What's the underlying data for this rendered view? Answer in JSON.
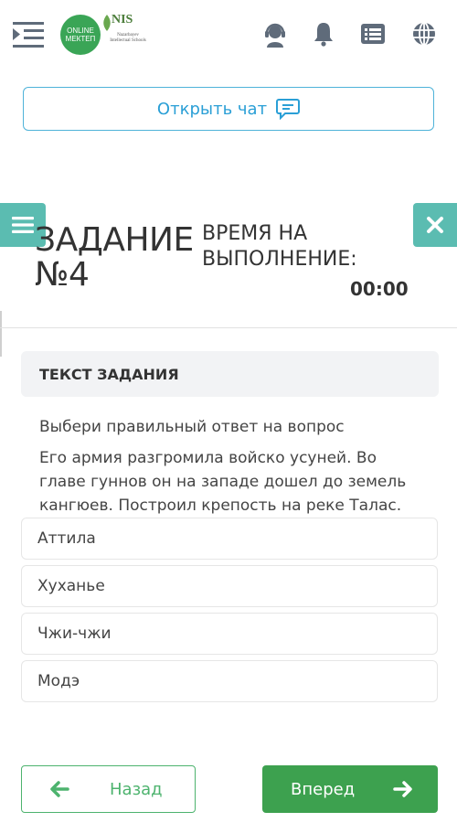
{
  "header": {
    "logo_online_line1": "ONLINE",
    "logo_online_line2": "МЕКТЕП",
    "logo_nis_mark": "NIS",
    "logo_nis_sub": "Nazarbayev Intellectual Schools",
    "icons": [
      "menu-icon",
      "support-headset-icon",
      "bell-icon",
      "list-icon",
      "globe-icon"
    ]
  },
  "chat": {
    "label": "Открыть чат"
  },
  "task": {
    "title": "ЗАДАНИЕ №4",
    "time_label": "ВРЕМЯ НА ВЫПОЛНЕНИЕ:",
    "time_value": "00:00"
  },
  "section": {
    "title": "ТЕКСТ ЗАДАНИЯ"
  },
  "question": {
    "prompt": "Выбери правильный ответ на вопрос",
    "text": "Его армия разгромила войско усуней. Во главе гуннов он на западе дошел до земель кангюев. Построил крепость на реке Талас."
  },
  "answers": [
    "Аттила",
    "Хуханье",
    "Чжи-чжи",
    "Модэ"
  ],
  "nav": {
    "back_label": "Назад",
    "next_label": "Вперед"
  },
  "colors": {
    "teal": "#5bbcb1",
    "green": "#3da14f",
    "blue": "#2a9fd6",
    "icon_gray": "#5f6b7a"
  }
}
